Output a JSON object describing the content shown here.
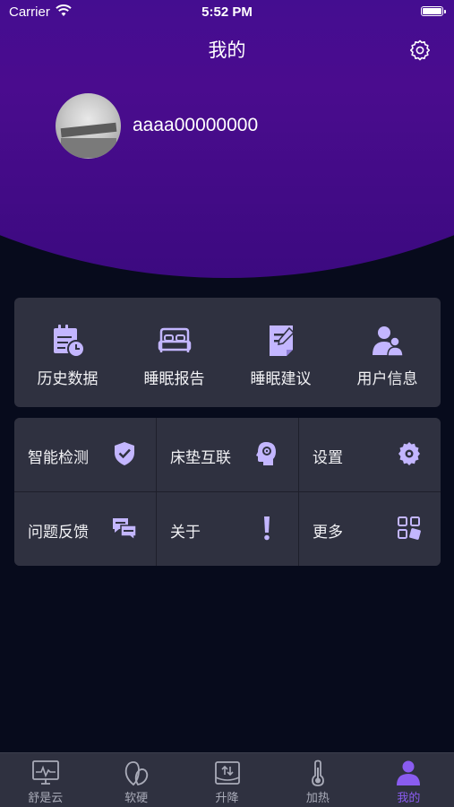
{
  "status_bar": {
    "carrier": "Carrier",
    "time": "5:52 PM"
  },
  "header": {
    "title": "我的"
  },
  "profile": {
    "username": "aaaa00000000"
  },
  "quick_actions": [
    {
      "label": "历史数据",
      "icon": "calendar-clock-icon"
    },
    {
      "label": "睡眠报告",
      "icon": "bed-icon"
    },
    {
      "label": "睡眠建议",
      "icon": "note-edit-icon"
    },
    {
      "label": "用户信息",
      "icon": "users-icon"
    }
  ],
  "menu": [
    {
      "label": "智能检测",
      "icon": "shield-check-icon"
    },
    {
      "label": "床垫互联",
      "icon": "head-brain-icon"
    },
    {
      "label": "设置",
      "icon": "gear-icon"
    },
    {
      "label": "问题反馈",
      "icon": "chat-bubbles-icon"
    },
    {
      "label": "关于",
      "icon": "exclamation-icon"
    },
    {
      "label": "更多",
      "icon": "grid-more-icon"
    }
  ],
  "tabbar": [
    {
      "label": "舒是云",
      "icon": "monitor-wave-icon",
      "active": false
    },
    {
      "label": "软硬",
      "icon": "leaves-icon",
      "active": false
    },
    {
      "label": "升降",
      "icon": "lift-icon",
      "active": false
    },
    {
      "label": "加热",
      "icon": "thermometer-icon",
      "active": false
    },
    {
      "label": "我的",
      "icon": "person-icon",
      "active": true
    }
  ],
  "colors": {
    "accent": "#8a5cf0",
    "icon_fill": "#c3b6ff",
    "card": "#2f3140",
    "background": "#070b1c"
  }
}
